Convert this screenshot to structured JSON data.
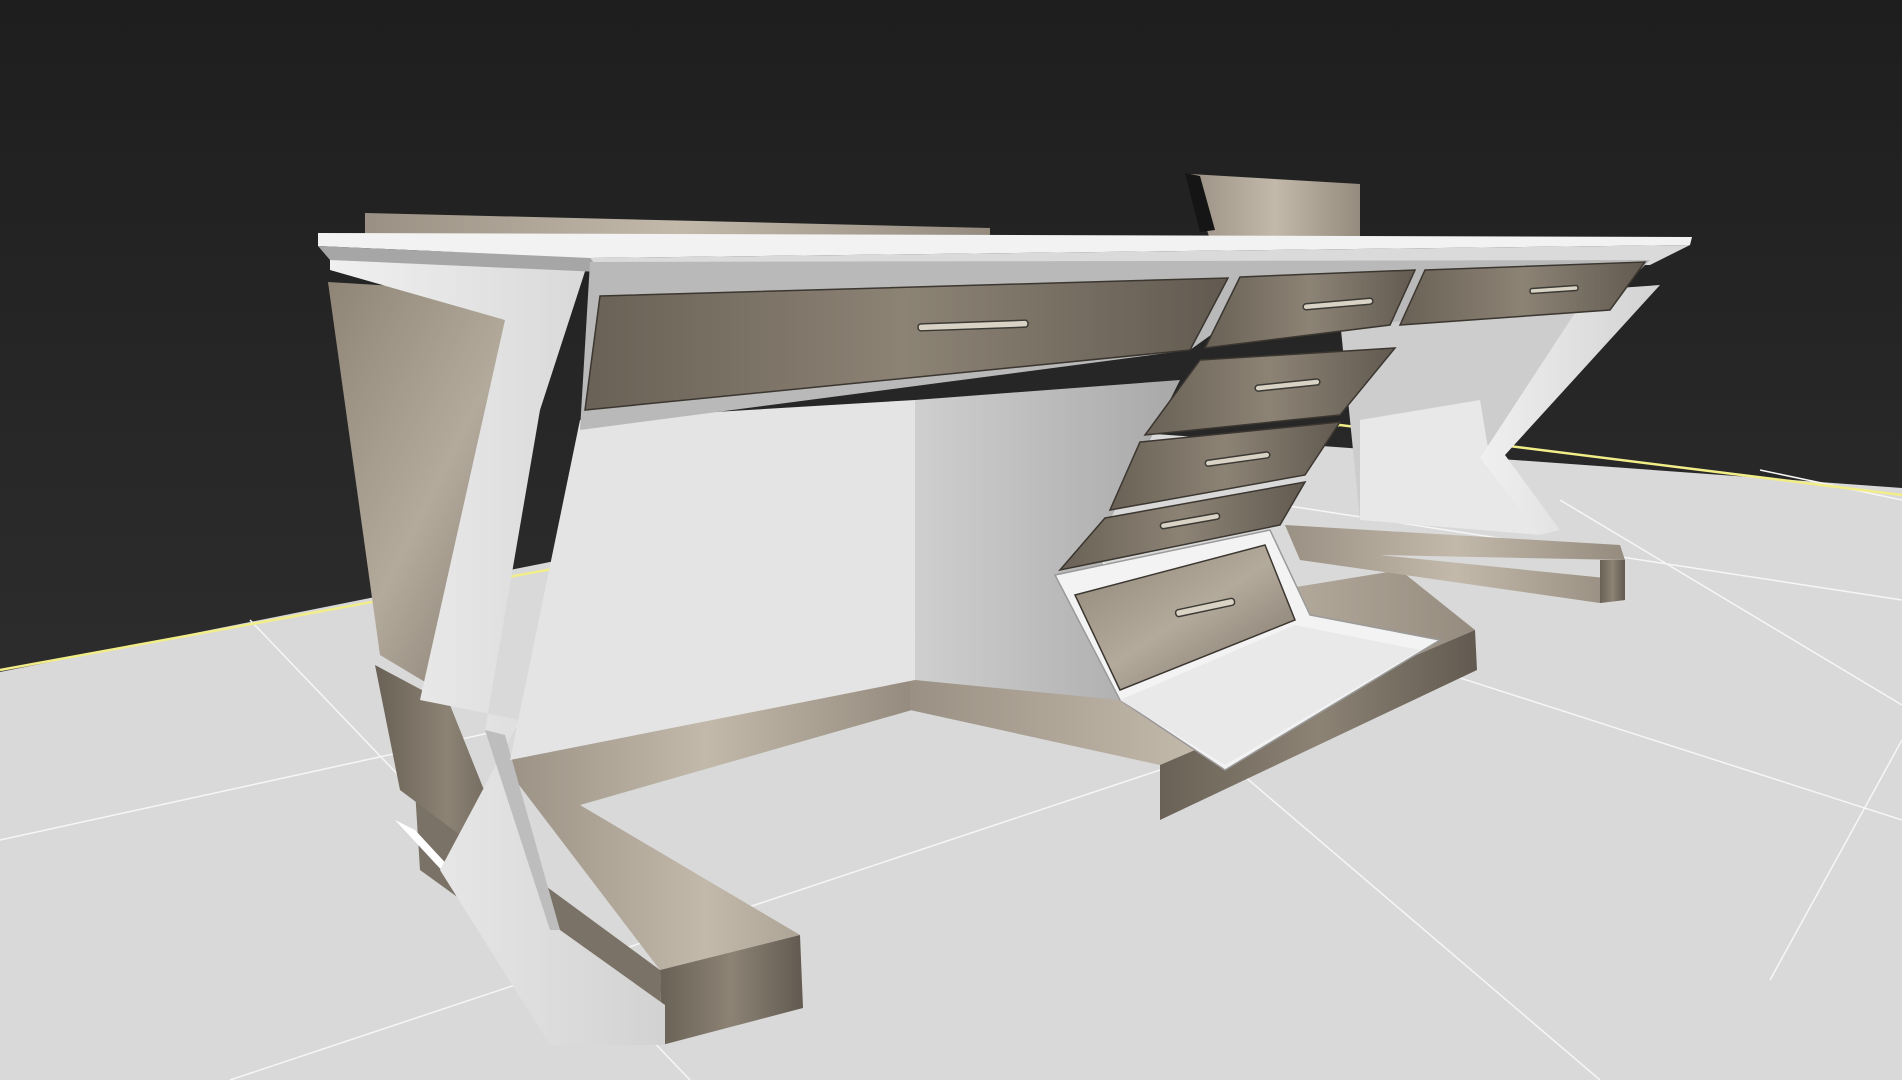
{
  "viewport": {
    "view_type": "3d-perspective-viewport",
    "content": "desk-model",
    "render_style": "shaded",
    "has_text": false
  },
  "colors": {
    "sky_top": "#1e1e1e",
    "sky_bottom": "#353535",
    "floor": "#d9d9d9",
    "floor_gridline": "#f6f6f6",
    "axis_line": "#f1ee8a",
    "wood_light": "#a49a8c",
    "wood_dark": "#6f665b",
    "white_panel": "#e4e4e4",
    "white_shadow": "#a9a9a9"
  },
  "object": {
    "name": "desk",
    "drawer_count": 7,
    "drawer_handles": 7
  }
}
